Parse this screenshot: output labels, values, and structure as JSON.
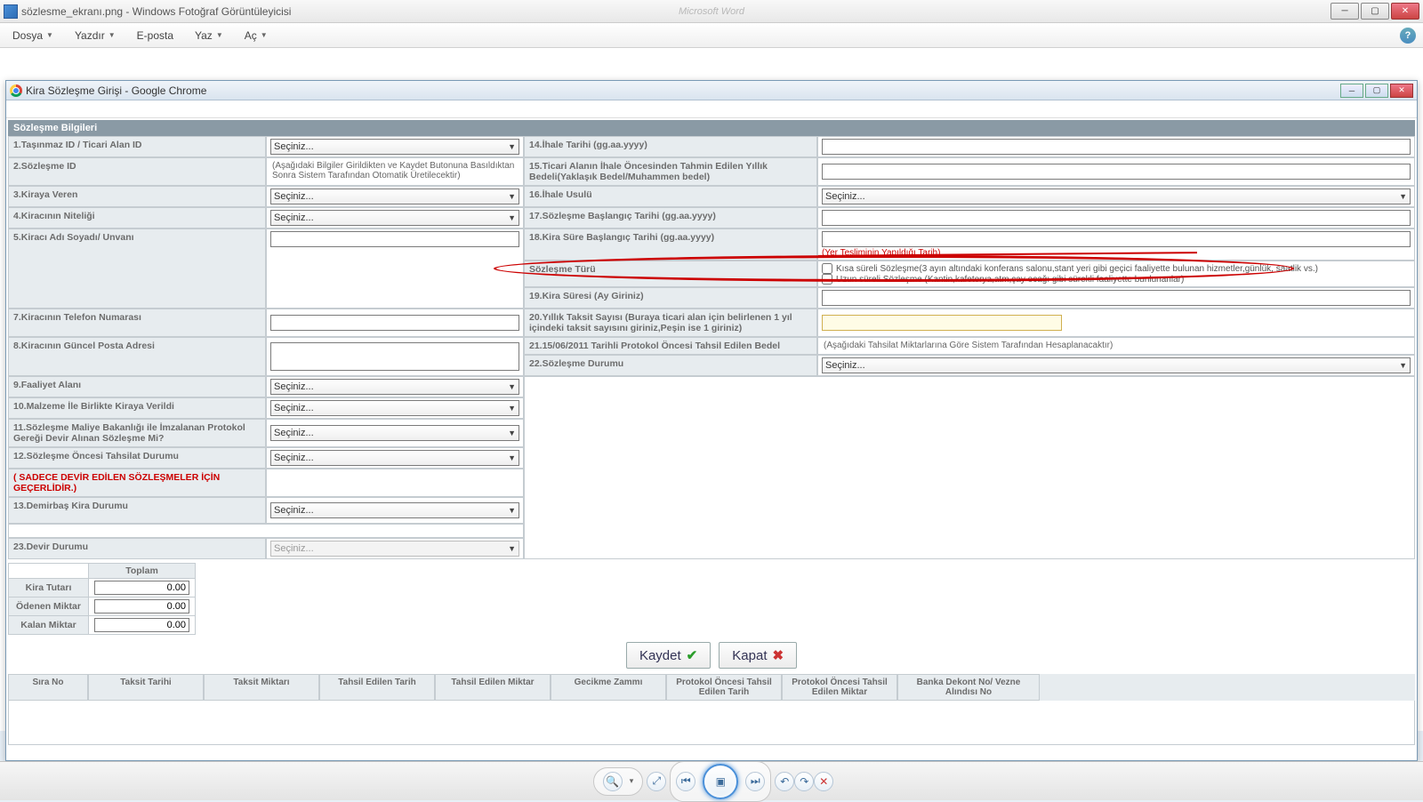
{
  "outer": {
    "title": "sözlesme_ekranı.png - Windows Fotoğraf Görüntüleyicisi",
    "faded_app": "Microsoft Word"
  },
  "menubar": {
    "file": "Dosya",
    "print": "Yazdır",
    "email": "E-posta",
    "burn": "Yaz",
    "open": "Aç"
  },
  "popup": {
    "title": "Kira Sözleşme Girişi - Google Chrome"
  },
  "section_title": "Sözleşme Bilgileri",
  "labels": {
    "l1": "1.Taşınmaz ID / Ticari Alan ID",
    "l2": "2.Sözleşme ID",
    "l3": "3.Kiraya Veren",
    "l4": "4.Kiracının Niteliği",
    "l5": "5.Kiracı Adı Soyadı/ Unvanı",
    "l7": "7.Kiracının Telefon Numarası",
    "l8": "8.Kiracının Güncel Posta Adresi",
    "l9": "9.Faaliyet Alanı",
    "l10": "10.Malzeme İle Birlikte Kiraya Verildi",
    "l11": "11.Sözleşme Maliye Bakanlığı ile İmzalanan Protokol Gereği Devir Alınan Sözleşme Mi?",
    "l12": "12.Sözleşme Öncesi Tahsilat Durumu",
    "l12_warn": "( SADECE DEVİR EDİLEN SÖZLEŞMELER İÇİN GEÇERLİDİR.)",
    "l13": "13.Demirbaş Kira Durumu",
    "l23": "23.Devir Durumu",
    "l14": "14.İhale Tarihi (gg.aa.yyyy)",
    "l15": "15.Ticari Alanın İhale Öncesinden Tahmin Edilen Yıllık Bedeli(Yaklaşık Bedel/Muhammen bedel)",
    "l16": "16.İhale Usulü",
    "l17": "17.Sözleşme Başlangıç Tarihi (gg.aa.yyyy)",
    "l18": "18.Kira Süre Başlangıç Tarihi (gg.aa.yyyy)",
    "l18_struck": "(Yer Tesliminin Yapıldığı Tarih)",
    "l_type": "Sözleşme Türü",
    "l19": "19.Kira Süresi (Ay Giriniz)",
    "l20": "20.Yıllık Taksit Sayısı (Buraya ticari alan için belirlenen 1 yıl içindeki taksit sayısını giriniz,Peşin ise 1 giriniz)",
    "l21": "21.15/06/2011 Tarihli Protokol Öncesi Tahsil Edilen Bedel",
    "l21_hint": "(Aşağıdaki Tahsilat Miktarlarına Göre Sistem Tarafından Hesaplanacaktır)",
    "l22": "22.Sözleşme Durumu",
    "l2_hint": "(Aşağıdaki Bilgiler Girildikten ve Kaydet Butonuna Basıldıktan Sonra Sistem Tarafından Otomatik Üretilecektir)"
  },
  "select_placeholder": "Seçiniz...",
  "type_options": {
    "short": "Kısa süreli Sözleşme(3 ayın altındaki konferans salonu,stant yeri gibi geçici faaliyette bulunan hizmetler,günlük, saatlik vs.)",
    "long": "Uzun süreli Sözleşme (Kantin,kafeterya,atm,çay ocağı gibi sürekli faaliyette bunlunanlar)"
  },
  "totals": {
    "header": "Toplam",
    "kira": "Kira Tutarı",
    "odenen": "Ödenen Miktar",
    "kalan": "Kalan Miktar",
    "zero": "0.00"
  },
  "buttons": {
    "save": "Kaydet",
    "close": "Kapat"
  },
  "grid": {
    "c1": "Sıra No",
    "c2": "Taksit Tarihi",
    "c3": "Taksit Miktarı",
    "c4": "Tahsil Edilen Tarih",
    "c5": "Tahsil Edilen Miktar",
    "c6": "Gecikme Zammı",
    "c7": "Protokol Öncesi Tahsil Edilen Tarih",
    "c8": "Protokol Öncesi Tahsil Edilen Miktar",
    "c9": "Banka Dekont No/ Vezne Alındısı No"
  }
}
